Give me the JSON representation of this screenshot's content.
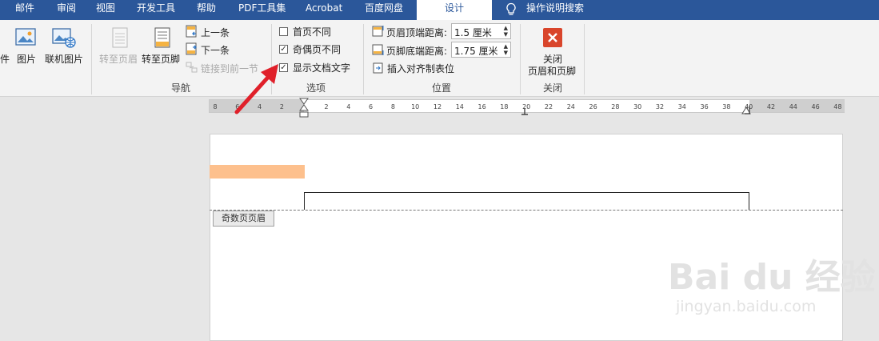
{
  "tabs": [
    {
      "label": "邮件"
    },
    {
      "label": "审阅"
    },
    {
      "label": "视图"
    },
    {
      "label": "开发工具"
    },
    {
      "label": "帮助"
    },
    {
      "label": "PDF工具集"
    },
    {
      "label": "Acrobat"
    },
    {
      "label": "百度网盘"
    },
    {
      "label": "设计"
    },
    {
      "label": "操作说明搜索"
    }
  ],
  "insert_group": {
    "partial_label": "件",
    "picture_label": "图片",
    "online_picture_label": "联机图片"
  },
  "nav_group": {
    "goto_header": "转至页眉",
    "goto_footer": "转至页脚",
    "previous": "上一条",
    "next": "下一条",
    "link_previous": "链接到前一节",
    "group_label": "导航"
  },
  "options_group": {
    "different_first_page": "首页不同",
    "different_first_checked": false,
    "different_odd_even": "奇偶页不同",
    "different_odd_even_checked": true,
    "show_doc_text": "显示文档文字",
    "show_doc_text_checked": true,
    "group_label": "选项",
    "check_mark": "✓"
  },
  "position_group": {
    "header_from_top_label": "页眉顶端距离:",
    "header_from_top_value": "1.5 厘米",
    "footer_from_bottom_label": "页脚底端距离:",
    "footer_from_bottom_value": "1.75 厘米",
    "insert_align_tab": "插入对齐制表位",
    "group_label": "位置"
  },
  "close_group": {
    "close_line1": "关闭",
    "close_line2": "页眉和页脚",
    "group_label": "关闭"
  },
  "ruler": {
    "ticks": [
      "8",
      "6",
      "4",
      "2",
      "",
      "2",
      "4",
      "6",
      "8",
      "10",
      "12",
      "14",
      "16",
      "18",
      "20",
      "22",
      "24",
      "26",
      "28",
      "30",
      "32",
      "34",
      "36",
      "38",
      "40",
      "42",
      "44",
      "46",
      "48"
    ]
  },
  "document": {
    "header_tag": "奇数页页眉"
  },
  "watermark": {
    "logo": "Bai du 经验",
    "url": "jingyan.baidu.com"
  },
  "colors": {
    "tab_bar": "#2b579a",
    "annotation_arrow": "#e0202a",
    "close_icon": "#d9452b",
    "shading": "#fdc08d"
  }
}
